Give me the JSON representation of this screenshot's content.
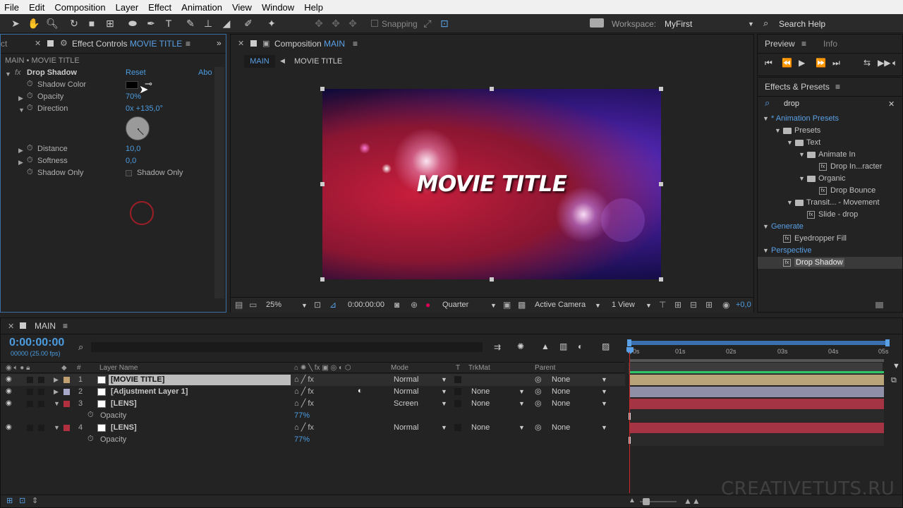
{
  "menu": [
    "File",
    "Edit",
    "Composition",
    "Layer",
    "Effect",
    "Animation",
    "View",
    "Window",
    "Help"
  ],
  "toolbar": {
    "snapping": "Snapping",
    "workspace_label": "Workspace:",
    "workspace_value": "MyFirst",
    "search_help": "Search Help"
  },
  "effect_controls": {
    "tab_left": "ct",
    "tab_label": "Effect Controls",
    "tab_comp": "MOVIE TITLE",
    "breadcrumb": "MAIN • MOVIE TITLE",
    "effect_name": "Drop Shadow",
    "reset": "Reset",
    "about": "Abo",
    "props": [
      {
        "name": "Shadow Color",
        "value": ""
      },
      {
        "name": "Opacity",
        "value": "70%"
      },
      {
        "name": "Direction",
        "value": "0x +135,0°"
      },
      {
        "name": "Distance",
        "value": "10,0"
      },
      {
        "name": "Softness",
        "value": "0,0"
      },
      {
        "name": "Shadow Only",
        "value": "Shadow Only"
      }
    ]
  },
  "composition": {
    "tab_label": "Composition",
    "tab_comp": "MAIN",
    "crumbs": [
      "MAIN",
      "MOVIE TITLE"
    ],
    "title_text": "MOVIE TITLE",
    "zoom": "25%",
    "timecode": "0:00:00:00",
    "resolution": "Quarter",
    "camera": "Active Camera",
    "views": "1 View",
    "exposure": "+0,0"
  },
  "preview": {
    "tab": "Preview",
    "tab2": "Info"
  },
  "effects_presets": {
    "tab": "Effects & Presets",
    "search": "drop",
    "tree": [
      {
        "label": "* Animation Presets",
        "indent": 0,
        "type": "cat"
      },
      {
        "label": "Presets",
        "indent": 1,
        "type": "folder"
      },
      {
        "label": "Text",
        "indent": 2,
        "type": "folder"
      },
      {
        "label": "Animate In",
        "indent": 3,
        "type": "folder"
      },
      {
        "label": "Drop In...racter",
        "indent": 4,
        "type": "item"
      },
      {
        "label": "Organic",
        "indent": 3,
        "type": "folder"
      },
      {
        "label": "Drop Bounce",
        "indent": 4,
        "type": "item"
      },
      {
        "label": "Transit... - Movement",
        "indent": 2,
        "type": "folder"
      },
      {
        "label": "Slide - drop",
        "indent": 3,
        "type": "item"
      },
      {
        "label": "Generate",
        "indent": 0,
        "type": "cat"
      },
      {
        "label": "Eyedropper Fill",
        "indent": 1,
        "type": "item"
      },
      {
        "label": "Perspective",
        "indent": 0,
        "type": "cat"
      },
      {
        "label": "Drop Shadow",
        "indent": 1,
        "type": "item",
        "selected": true
      }
    ]
  },
  "timeline": {
    "tab": "MAIN",
    "timecode": "0:00:00:00",
    "fps": "00000 (25.00 fps)",
    "headers": {
      "hash": "#",
      "layer_name": "Layer Name",
      "mode": "Mode",
      "t": "T",
      "trkmat": "TrkMat",
      "parent": "Parent"
    },
    "ruler": [
      "0s",
      "01s",
      "02s",
      "03s",
      "04s",
      "05s"
    ],
    "layers": [
      {
        "num": "1",
        "name": "[MOVIE TITLE]",
        "mode": "Normal",
        "trkmat": "",
        "parent": "None",
        "color": "#c0a070",
        "bar": "#b9a47a"
      },
      {
        "num": "2",
        "name": "[Adjustment Layer 1]",
        "mode": "Normal",
        "trkmat": "None",
        "parent": "None",
        "color": "#a8a8c8",
        "bar": "#8f8fa8"
      },
      {
        "num": "3",
        "name": "[LENS]",
        "mode": "Screen",
        "trkmat": "None",
        "parent": "None",
        "color": "#b03040",
        "bar": "#a43344",
        "sub": "Opacity",
        "subval": "77%"
      },
      {
        "num": "4",
        "name": "[LENS]",
        "mode": "Normal",
        "trkmat": "None",
        "parent": "None",
        "color": "#b03040",
        "bar": "#a43344",
        "sub": "Opacity",
        "subval": "77%"
      }
    ]
  },
  "watermark": "CREATIVETUTS.RU"
}
